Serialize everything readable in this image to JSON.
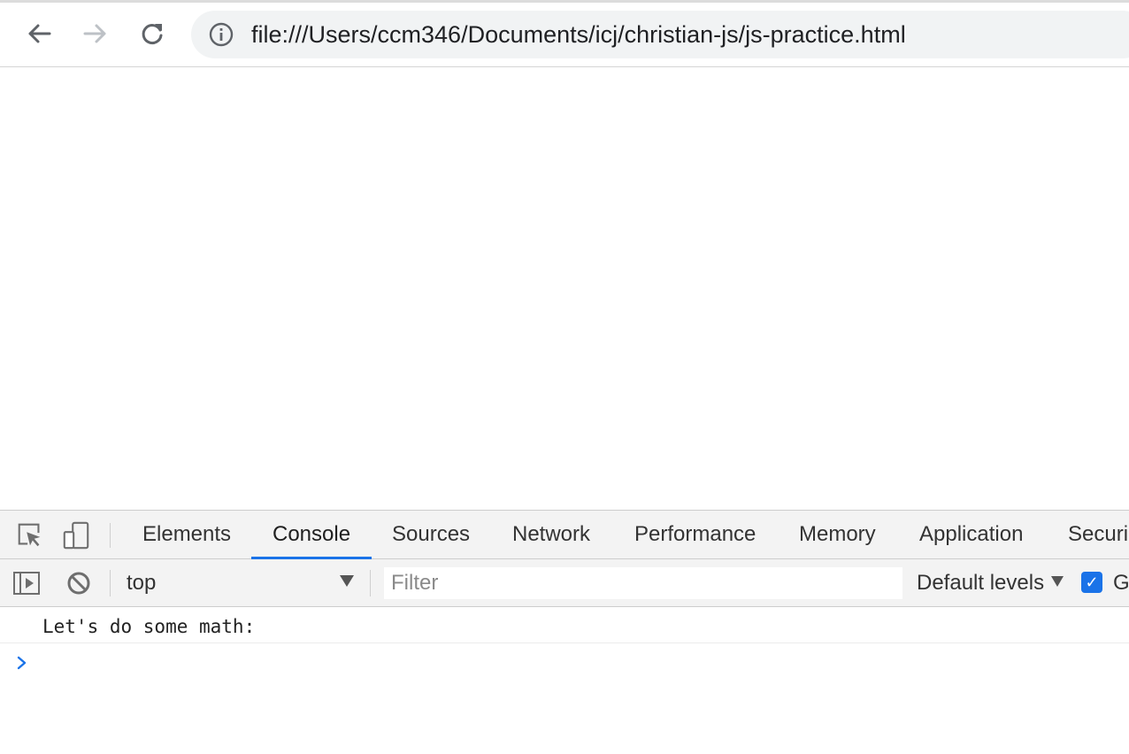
{
  "browser": {
    "url": "file:///Users/ccm346/Documents/icj/christian-js/js-practice.html",
    "icons": {
      "back": "arrow-left-icon",
      "forward": "arrow-right-icon",
      "reload": "reload-icon",
      "info": "info-icon"
    }
  },
  "devtools": {
    "tabs": [
      {
        "label": "Elements",
        "active": false
      },
      {
        "label": "Console",
        "active": true
      },
      {
        "label": "Sources",
        "active": false
      },
      {
        "label": "Network",
        "active": false
      },
      {
        "label": "Performance",
        "active": false
      },
      {
        "label": "Memory",
        "active": false
      },
      {
        "label": "Application",
        "active": false
      },
      {
        "label": "Securi",
        "active": false
      }
    ],
    "console_bar": {
      "context": "top",
      "filter_placeholder": "Filter",
      "levels": "Default levels",
      "checkbox_checked": true,
      "checkbox_label": "G"
    },
    "messages": [
      {
        "text": "Let's do some math:"
      }
    ],
    "accent_color": "#1a73e8"
  }
}
